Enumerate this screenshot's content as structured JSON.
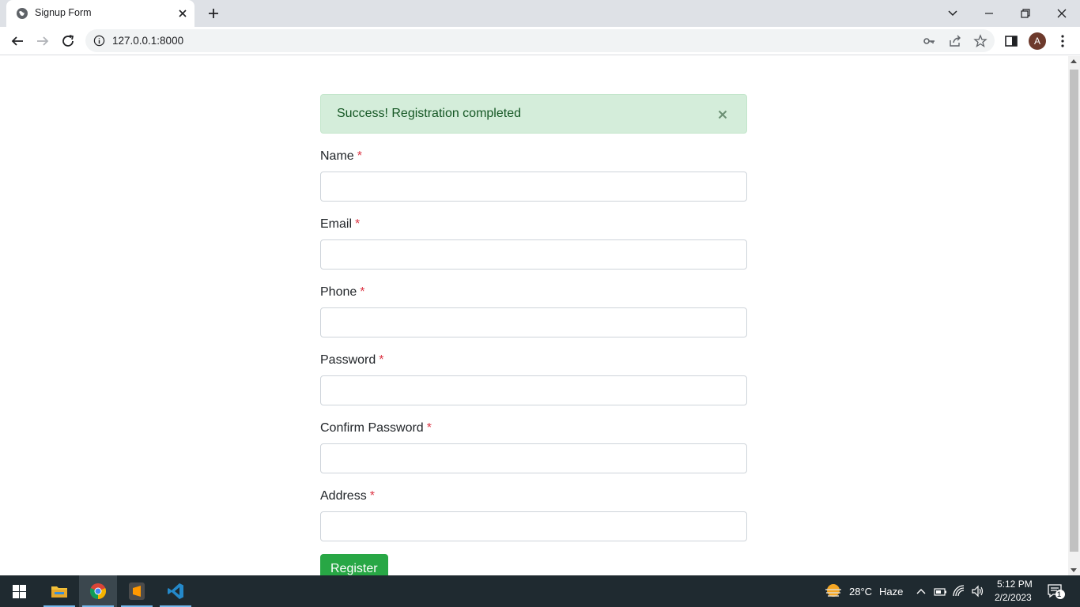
{
  "browser": {
    "tab_title": "Signup Form",
    "url": "127.0.0.1:8000",
    "avatar_letter": "A"
  },
  "alert": {
    "message": "Success! Registration completed",
    "close_glyph": "×"
  },
  "form": {
    "required_mark": "*",
    "fields": [
      {
        "label": "Name",
        "value": ""
      },
      {
        "label": "Email",
        "value": ""
      },
      {
        "label": "Phone",
        "value": ""
      },
      {
        "label": "Password",
        "value": ""
      },
      {
        "label": "Confirm Password",
        "value": ""
      },
      {
        "label": "Address",
        "value": ""
      }
    ],
    "submit_label": "Register"
  },
  "taskbar": {
    "weather_temp": "28°C",
    "weather_desc": "Haze",
    "time": "5:12 PM",
    "date": "2/2/2023",
    "notification_count": "1"
  },
  "colors": {
    "alert_bg": "#d4edda",
    "alert_text": "#155724",
    "required": "#dc3545",
    "button": "#28a745"
  }
}
